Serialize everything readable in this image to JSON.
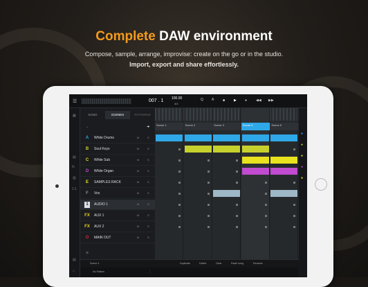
{
  "promo": {
    "headline_accent": "Complete",
    "headline_rest": "DAW environment",
    "line1": "Compose, sample, arrange, improvise: create on the go or in the studio.",
    "line2": "Import, export and share effortlessly."
  },
  "transport": {
    "position": "007 . 1",
    "tempo": "100.00",
    "signature": "4/4",
    "qlabel": "Q",
    "alabel": "A"
  },
  "tabs": [
    "SONG",
    "SCENES",
    "PATTERNS"
  ],
  "tracks": [
    {
      "letter": "A",
      "name": "White Drums",
      "color": "#2fa8e8"
    },
    {
      "letter": "B",
      "name": "Soul Keys",
      "color": "#c7d12e"
    },
    {
      "letter": "C",
      "name": "White Sub",
      "color": "#e8e21f"
    },
    {
      "letter": "D",
      "name": "White Organ",
      "color": "#c04ad0"
    },
    {
      "letter": "E",
      "name": "SAMPLES RACK",
      "color": "#e8e21f"
    },
    {
      "letter": "F",
      "name": "Vox",
      "color": "#8a8f94"
    },
    {
      "letter": "1",
      "name": "AUDIO 1",
      "color": "#8a8f94"
    },
    {
      "letter": "FX",
      "name": "AUX 1",
      "color": "#e8d21f"
    },
    {
      "letter": "FX",
      "name": "AUX 2",
      "color": "#e8d21f"
    },
    {
      "letter": "O",
      "name": "MAIN OUT",
      "color": "#d0283a"
    }
  ],
  "scenes": [
    "Scene 1",
    "Scene 2",
    "Scene 3",
    "Scene 4",
    "Scene 5"
  ],
  "bottom_actions": [
    "Duplicate",
    "Delete",
    "Clear",
    "Paste song",
    "Rename"
  ],
  "status": {
    "scene": "Scene 4",
    "pattern": "No Pattern"
  }
}
